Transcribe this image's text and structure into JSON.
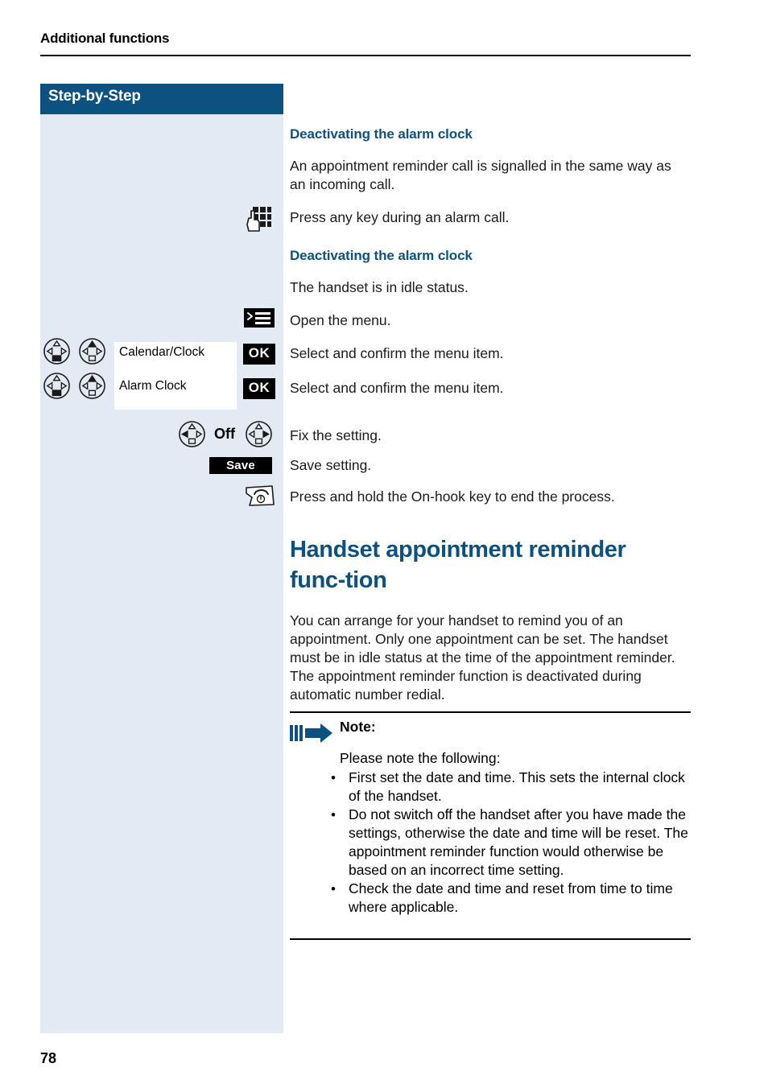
{
  "running_head": "Additional functions",
  "sidebar": {
    "header_label": "Step-by-Step",
    "menu_boxes": [
      {
        "label": "Calendar/Clock",
        "confirm_key": "OK"
      },
      {
        "label": "Alarm Clock",
        "confirm_key": "OK"
      }
    ],
    "off_label": "Off",
    "save_key_label": "Save"
  },
  "content": {
    "section1_heading": "Deactivating the alarm clock",
    "section1_paragraph": "An appointment reminder call is signalled in the same way as an incoming call.",
    "step_press_any_key": "Press any key during an alarm call.",
    "section2_heading": "Deactivating the alarm clock",
    "step_idle_status": "The handset is in idle status.",
    "step_open_menu": "Open the menu.",
    "step_select_confirm_1": "Select and confirm the menu item.",
    "step_select_confirm_2": "Select and confirm the menu item.",
    "step_fix_setting": "Fix the setting.",
    "step_save_setting": "Save setting.",
    "step_end_process": "Press and hold the On-hook key to end the process.",
    "main_title": "Handset appointment reminder func-­tion",
    "main_paragraph": "You can arrange for your handset to remind you of an appointment. Only one appointment can be set. The handset must be in idle status at the time of the appointment reminder. The appointment reminder function is deactivated during automatic number redial."
  },
  "note": {
    "label": "Note:",
    "intro": "Please note the following:",
    "bullet_marker": "•",
    "bullets": [
      "First set the date and time. This sets the internal clock of the handset.",
      "Do not switch off the handset after you have made the settings, otherwise the date and time will be reset. The appointment reminder function would otherwise be based on an incorrect time setting.",
      "Check the date and time and reset from time to time where applicable."
    ]
  },
  "footer": {
    "page_number": "78"
  },
  "colors": {
    "accent_blue": "#0d5180",
    "sidebar_bg": "#e3eaf3",
    "key_black": "#000000"
  }
}
